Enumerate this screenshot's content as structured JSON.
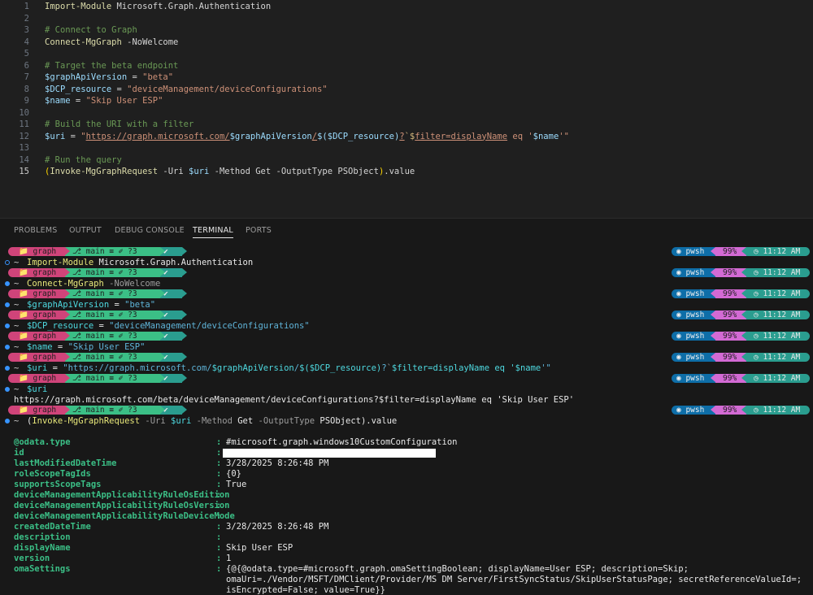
{
  "editor": {
    "lines": [
      {
        "n": "1",
        "tokens": [
          [
            "cmd",
            "Import-Module"
          ],
          [
            "plain",
            " Microsoft.Graph.Authentication"
          ]
        ]
      },
      {
        "n": "2",
        "tokens": []
      },
      {
        "n": "3",
        "tokens": [
          [
            "cmt",
            "# Connect to Graph"
          ]
        ]
      },
      {
        "n": "4",
        "tokens": [
          [
            "cmd",
            "Connect-MgGraph"
          ],
          [
            "plain",
            " -NoWelcome"
          ]
        ]
      },
      {
        "n": "5",
        "tokens": []
      },
      {
        "n": "6",
        "tokens": [
          [
            "cmt",
            "# Target the beta endpoint"
          ]
        ]
      },
      {
        "n": "7",
        "tokens": [
          [
            "var",
            "$graphApiVersion"
          ],
          [
            "plain",
            " = "
          ],
          [
            "str",
            "\"beta\""
          ]
        ]
      },
      {
        "n": "8",
        "tokens": [
          [
            "var",
            "$DCP_resource"
          ],
          [
            "plain",
            " = "
          ],
          [
            "str",
            "\"deviceManagement/deviceConfigurations\""
          ]
        ]
      },
      {
        "n": "9",
        "tokens": [
          [
            "var",
            "$name"
          ],
          [
            "plain",
            " = "
          ],
          [
            "str",
            "\"Skip User ESP\""
          ]
        ]
      },
      {
        "n": "10",
        "tokens": []
      },
      {
        "n": "11",
        "tokens": [
          [
            "cmt",
            "# Build the URI with a filter"
          ]
        ]
      },
      {
        "n": "12",
        "tokens": [
          [
            "var",
            "$uri"
          ],
          [
            "plain",
            " = "
          ],
          [
            "str",
            "\""
          ],
          [
            "strul",
            "https://graph.microsoft.com/"
          ],
          [
            "var",
            "$graphApiVersion"
          ],
          [
            "strul",
            "/"
          ],
          [
            "var",
            "$("
          ],
          [
            "var",
            "$DCP_resource"
          ],
          [
            "var",
            ")"
          ],
          [
            "strul",
            "?"
          ],
          [
            "esc",
            "`$"
          ],
          [
            "strul",
            "filter=displayName"
          ],
          [
            "str",
            " eq '"
          ],
          [
            "var",
            "$name"
          ],
          [
            "str",
            "'\""
          ]
        ]
      },
      {
        "n": "13",
        "tokens": []
      },
      {
        "n": "14",
        "tokens": [
          [
            "cmt",
            "# Run the query"
          ]
        ]
      },
      {
        "n": "15",
        "tokens": [
          [
            "par",
            "("
          ],
          [
            "cmd",
            "Invoke-MgGraphRequest"
          ],
          [
            "plain",
            " -Uri "
          ],
          [
            "var",
            "$uri"
          ],
          [
            "plain",
            " -Method Get -OutputType PSObject"
          ],
          [
            "par",
            ")"
          ],
          [
            "plain",
            ".value"
          ]
        ]
      }
    ],
    "active_line": "15"
  },
  "panel": {
    "tabs": [
      "PROBLEMS",
      "OUTPUT",
      "DEBUG CONSOLE",
      "TERMINAL",
      "PORTS"
    ],
    "active_tab": "TERMINAL"
  },
  "prompt": {
    "dir": "📁 graph",
    "git": "⎇ main ≡ ✐ ?3",
    "status": "✔",
    "shell": "◉ pwsh",
    "battery": "99%",
    "time": "◷ 11:12 AM"
  },
  "terminal": {
    "commands": [
      {
        "tokens": [
          [
            "tcmd",
            "Import-Module"
          ],
          [
            "tplain",
            " Microsoft.Graph.Authentication"
          ]
        ]
      },
      {
        "tokens": [
          [
            "tcmd",
            "Connect-MgGraph"
          ],
          [
            "tpar",
            " -NoWelcome"
          ]
        ]
      },
      {
        "tokens": [
          [
            "tvar",
            "$graphApiVersion"
          ],
          [
            "tplain",
            " = "
          ],
          [
            "tstr",
            "\"beta\""
          ]
        ]
      },
      {
        "tokens": [
          [
            "tvar",
            "$DCP_resource"
          ],
          [
            "tplain",
            " = "
          ],
          [
            "tstr",
            "\"deviceManagement/deviceConfigurations\""
          ]
        ]
      },
      {
        "tokens": [
          [
            "tvar",
            "$name"
          ],
          [
            "tplain",
            " = "
          ],
          [
            "tstr",
            "\"Skip User ESP\""
          ]
        ]
      },
      {
        "tokens": [
          [
            "tvar",
            "$uri"
          ],
          [
            "tplain",
            " = "
          ],
          [
            "tstr",
            "\"https://graph.microsoft.com/"
          ],
          [
            "tvar",
            "$graphApiVersion"
          ],
          [
            "tstr",
            "/"
          ],
          [
            "tvar",
            "$("
          ],
          [
            "tvar",
            "$DCP_resource"
          ],
          [
            "tvar",
            ")"
          ],
          [
            "tstr",
            "?"
          ],
          [
            "tpar",
            "`"
          ],
          [
            "tvar",
            "$filter=displayName eq '"
          ],
          [
            "tvar",
            "$name"
          ],
          [
            "tstr",
            "'\""
          ]
        ]
      },
      {
        "tokens": [
          [
            "tvar",
            "$uri"
          ]
        ]
      },
      {
        "tokens": [
          [
            "tplain",
            "("
          ],
          [
            "tcmd",
            "Invoke-MgGraphRequest"
          ],
          [
            "tpar",
            " -Uri "
          ],
          [
            "tvar",
            "$uri"
          ],
          [
            "tpar",
            " -Method "
          ],
          [
            "tplain",
            "Get"
          ],
          [
            "tpar",
            " -OutputType "
          ],
          [
            "tplain",
            "PSObject).value"
          ]
        ]
      }
    ],
    "uri_output": "https://graph.microsoft.com/beta/deviceManagement/deviceConfigurations?$filter=displayName eq 'Skip User ESP'",
    "properties": [
      {
        "key": "@odata.type",
        "value": "#microsoft.graph.windows10CustomConfiguration"
      },
      {
        "key": "id",
        "value": "",
        "redacted": true
      },
      {
        "key": "lastModifiedDateTime",
        "value": "3/28/2025 8:26:48 PM"
      },
      {
        "key": "roleScopeTagIds",
        "value": "{0}"
      },
      {
        "key": "supportsScopeTags",
        "value": "True"
      },
      {
        "key": "deviceManagementApplicabilityRuleOsEdition",
        "value": ""
      },
      {
        "key": "deviceManagementApplicabilityRuleOsVersion",
        "value": ""
      },
      {
        "key": "deviceManagementApplicabilityRuleDeviceMode",
        "value": ""
      },
      {
        "key": "createdDateTime",
        "value": "3/28/2025 8:26:48 PM"
      },
      {
        "key": "description",
        "value": ""
      },
      {
        "key": "displayName",
        "value": "Skip User ESP"
      },
      {
        "key": "version",
        "value": "1"
      },
      {
        "key": "omaSettings",
        "value": "{@{@odata.type=#microsoft.graph.omaSettingBoolean; displayName=User ESP; description=Skip;"
      }
    ],
    "oma_continued": [
      "omaUri=./Vendor/MSFT/DMClient/Provider/MS DM Server/FirstSyncStatus/SkipUserStatusPage; secretReferenceValueId=;",
      "isEncrypted=False; value=True}}"
    ]
  },
  "colors": {
    "editor_bg": "#1f1f1f",
    "terminal_bg": "#181818",
    "prompt_dir": "#d0447a",
    "prompt_git": "#3bbf86",
    "prompt_shell": "#0e6ea8",
    "prompt_battery": "#d36ad4",
    "prompt_time": "#2a9d8f"
  }
}
